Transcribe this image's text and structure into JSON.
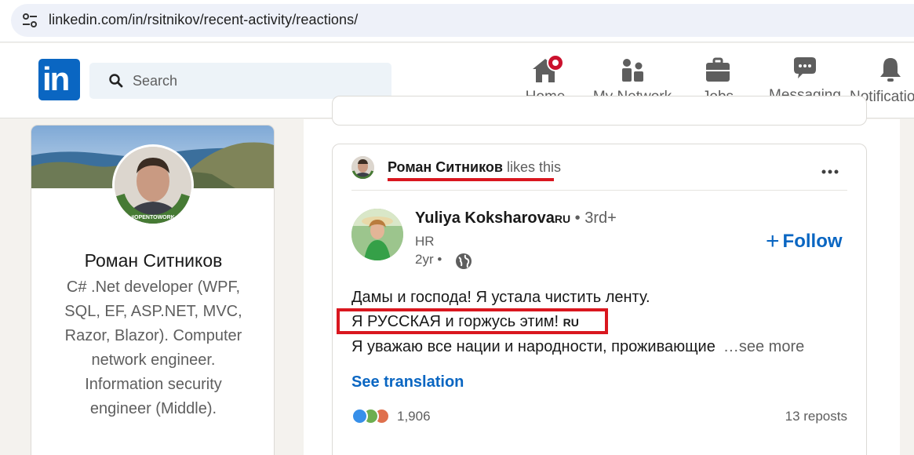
{
  "browser": {
    "url": "linkedin.com/in/rsitnikov/recent-activity/reactions/"
  },
  "header": {
    "search_placeholder": "Search",
    "nav": [
      {
        "label": "Home",
        "icon": "home-icon",
        "has_badge": true
      },
      {
        "label": "My Network",
        "icon": "people-icon"
      },
      {
        "label": "Jobs",
        "icon": "briefcase-icon"
      },
      {
        "label": "Messaging",
        "icon": "chat-icon"
      },
      {
        "label": "Notifications",
        "icon": "bell-icon"
      }
    ]
  },
  "profile": {
    "name": "Роман Ситников",
    "open_to_work": "#OPENTOWORK",
    "headline": "C# .Net developer (WPF, SQL, EF, ASP.NET, MVC, Razor, Blazor). Computer network engineer. Information security engineer (Middle)."
  },
  "post": {
    "context_name": "Роман Ситников",
    "context_action": "likes this",
    "author_name": "Yuliya Koksharova",
    "author_flag": "RU",
    "author_degree": "• 3rd+",
    "author_title": "HR",
    "time": "2yr •",
    "follow_label": "Follow",
    "lines": [
      "Дамы и господа! Я устала чистить ленту.",
      "Я РУССКАЯ и горжусь этим!",
      "Я уважаю все нации и народности, проживающие"
    ],
    "line2_flag": "RU",
    "see_more": "…see more",
    "translate_label": "See translation",
    "reaction_count": "1,906",
    "reposts": "13 reposts"
  },
  "colors": {
    "brand": "#0a66c2",
    "highlight": "#d9171f",
    "badge": "#cb112d"
  }
}
